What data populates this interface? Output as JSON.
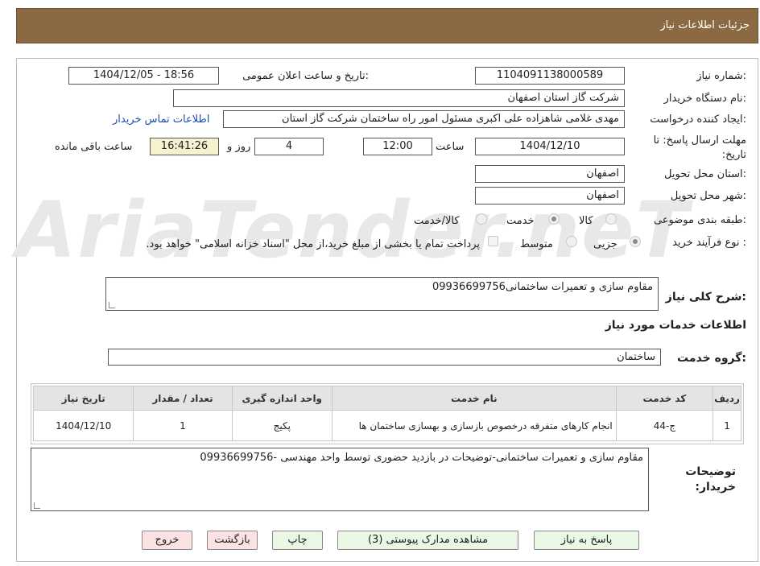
{
  "header": {
    "title": "جزئیات اطلاعات نیاز"
  },
  "watermark": {
    "text": "AriaTender.neT"
  },
  "form": {
    "need_number_label": "شماره نیاز:",
    "need_number": "1104091138000589",
    "announce_label": "تاریخ و ساعت اعلان عمومی:",
    "announce_value": "1404/12/05 - 18:56",
    "buyer_org_label": "نام دستگاه خریدار:",
    "buyer_org": "شرکت گاز استان اصفهان",
    "requester_label": "ایجاد کننده درخواست:",
    "requester": "مهدی غلامی شاهزاده علی اکبری مسئول امور راه ساختمان شرکت گاز استان",
    "contact_link": "اطلاعات تماس خریدار",
    "deadline_label": "مهلت ارسال پاسخ: تا تاریخ:",
    "deadline_date": "1404/12/10",
    "time_label": "ساعت",
    "deadline_time": "12:00",
    "days_value": "4",
    "days_label": "روز و",
    "remaining_time": "16:41:26",
    "remaining_label": "ساعت باقی مانده",
    "province_label": "استان محل تحویل:",
    "province": "اصفهان",
    "city_label": "شهر محل تحویل:",
    "city": "اصفهان",
    "category_label": "طبقه بندی موضوعی:",
    "category_options": [
      "کالا",
      "خدمت",
      "کالا/خدمت"
    ],
    "category_selected": "خدمت",
    "process_label": "نوع فرآیند خرید :",
    "process_options": [
      "جزیی",
      "متوسط"
    ],
    "process_selected": "جزیی",
    "payment_note": "پرداخت تمام یا بخشی از مبلغ خرید،از محل \"اسناد خزانه اسلامی\" خواهد بود.",
    "summary_label": "شرح کلی نیاز:",
    "summary": "مقاوم سازی و تعمیرات ساختمانی09936699756",
    "services_heading": "اطلاعات خدمات مورد نیاز",
    "service_group_label": "گروه خدمت:",
    "service_group": "ساختمان"
  },
  "table": {
    "headers": [
      "ردیف",
      "کد خدمت",
      "نام خدمت",
      "واحد اندازه گیری",
      "تعداد / مقدار",
      "تاریخ نیاز"
    ],
    "rows": [
      {
        "row": "1",
        "code": "ج-44",
        "name": "انجام کارهای متفرقه درخصوص بازسازی و بهسازی ساختمان ها",
        "unit": "پکیج",
        "qty": "1",
        "date": "1404/12/10"
      }
    ]
  },
  "notes": {
    "label": "توضیحات خریدار:",
    "text": "مقاوم سازی و تعمیرات ساختمانی-توضیحات در بازدید حضوری توسط واحد مهندسی -09936699756"
  },
  "buttons": {
    "reply": "پاسخ به نیاز",
    "attachments": "مشاهده مدارک پیوستی (3)",
    "print": "چاپ",
    "back": "بازگشت",
    "exit": "خروج"
  },
  "colors": {
    "header_bg": "#8b6a43",
    "button_green": "#e9f7e4",
    "button_pink": "#fbe3e3",
    "link": "#1a4fb8"
  }
}
